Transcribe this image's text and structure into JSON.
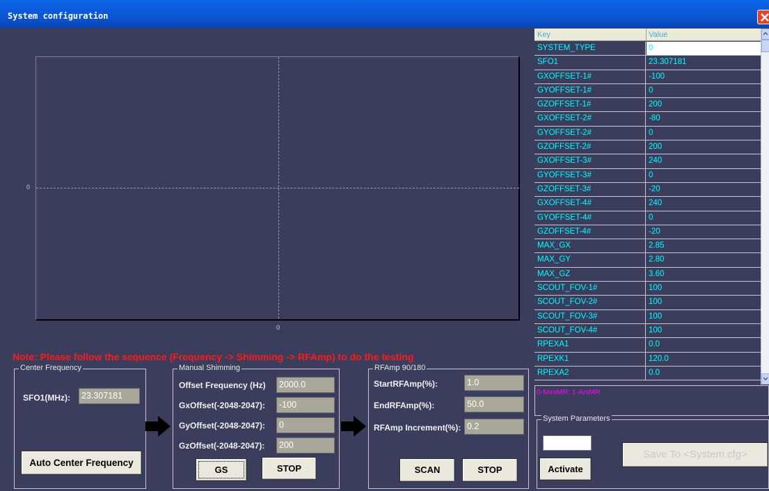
{
  "window": {
    "title": "System configuration"
  },
  "plot": {
    "x_tick": "0",
    "y_tick": "0"
  },
  "grid": {
    "header_key": "Key",
    "header_value": "Value",
    "rows": [
      {
        "key": "SYSTEM_TYPE",
        "value": "0"
      },
      {
        "key": "SFO1",
        "value": "23.307181"
      },
      {
        "key": "GXOFFSET-1#",
        "value": "-100"
      },
      {
        "key": "GYOFFSET-1#",
        "value": "0"
      },
      {
        "key": "GZOFFSET-1#",
        "value": "200"
      },
      {
        "key": "GXOFFSET-2#",
        "value": "-80"
      },
      {
        "key": "GYOFFSET-2#",
        "value": "0"
      },
      {
        "key": "GZOFFSET-2#",
        "value": "200"
      },
      {
        "key": "GXOFFSET-3#",
        "value": "240"
      },
      {
        "key": "GYOFFSET-3#",
        "value": "0"
      },
      {
        "key": "GZOFFSET-3#",
        "value": "-20"
      },
      {
        "key": "GXOFFSET-4#",
        "value": "240"
      },
      {
        "key": "GYOFFSET-4#",
        "value": "0"
      },
      {
        "key": "GZOFFSET-4#",
        "value": "-20"
      },
      {
        "key": "MAX_GX",
        "value": "2.85"
      },
      {
        "key": "MAX_GY",
        "value": "2.80"
      },
      {
        "key": "MAX_GZ",
        "value": "3.60"
      },
      {
        "key": "SCOUT_FOV-1#",
        "value": "100"
      },
      {
        "key": "SCOUT_FOV-2#",
        "value": "100"
      },
      {
        "key": "SCOUT_FOV-3#",
        "value": "100"
      },
      {
        "key": "SCOUT_FOV-4#",
        "value": "100"
      },
      {
        "key": "RPEXA1",
        "value": "0.0"
      },
      {
        "key": "RPEXK1",
        "value": "120.0"
      },
      {
        "key": "RPEXA2",
        "value": "0.0"
      }
    ],
    "description": "0-MiniMR; 1-AniMR"
  },
  "note": "Note: Please follow the sequence (Frequency -> Shimming -> RFAmp) to do the testing",
  "center_frequency": {
    "legend": "Center Frequency",
    "sfo1_label": "SFO1(MHz):",
    "sfo1_value": "23.307181",
    "auto_button": "Auto Center Frequency"
  },
  "manual_shimming": {
    "legend": "Manual Shimming",
    "offset_freq_label": "Offset Frequency (Hz)",
    "offset_freq_value": "2000.0",
    "gx_label": "GxOffset(-2048-2047):",
    "gx_value": "-100",
    "gy_label": "GyOffset(-2048-2047):",
    "gy_value": "0",
    "gz_label": "GzOffset(-2048-2047):",
    "gz_value": "200",
    "gs_button": "GS",
    "stop_button": "STOP"
  },
  "rfamp": {
    "legend": "RFAmp 90/180",
    "start_label": "StartRFAmp(%):",
    "start_value": "1.0",
    "end_label": "EndRFAmp(%):",
    "end_value": "50.0",
    "inc_label": "RFAmp Increment(%):",
    "inc_value": "0.2",
    "scan_button": "SCAN",
    "stop_button": "STOP"
  },
  "system_parameters": {
    "legend": "System Parameters",
    "activate_button": "Activate",
    "save_button": "Save To <System.cfg>"
  },
  "colors": {
    "accent_text": "#00ffff",
    "note_red": "#ff1a1a",
    "desc_magenta": "#ff00ff",
    "background": "#3a3d5c"
  }
}
